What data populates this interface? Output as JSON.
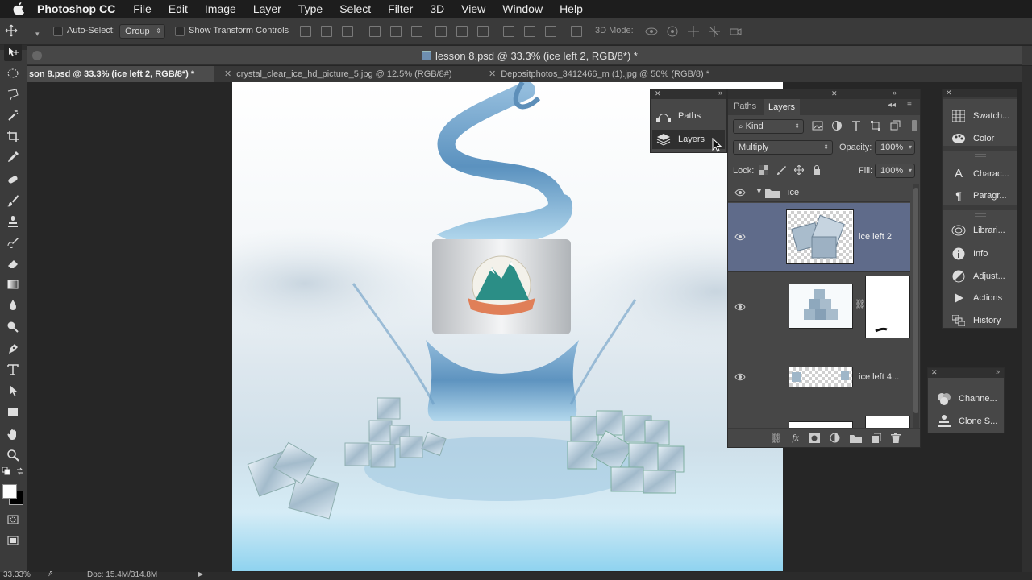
{
  "menubar": {
    "app_name": "Photoshop CC",
    "menus": [
      "File",
      "Edit",
      "Image",
      "Layer",
      "Type",
      "Select",
      "Filter",
      "3D",
      "View",
      "Window",
      "Help"
    ]
  },
  "options_bar": {
    "auto_select_label": "Auto-Select:",
    "auto_select_value": "Group",
    "transform_label": "Show Transform Controls",
    "mode_label": "3D Mode:"
  },
  "document": {
    "title": "lesson 8.psd @ 33.3% (ice left 2, RGB/8*) *",
    "tabs": [
      "son 8.psd @ 33.3% (ice left 2, RGB/8*) *",
      "crystal_clear_ice_hd_picture_5.jpg @ 12.5% (RGB/8#)",
      "Depositphotos_3412466_m (1).jpg @ 50% (RGB/8) *"
    ]
  },
  "status": {
    "zoom": "33.33%",
    "doc": "Doc: 15.4M/314.8M"
  },
  "collapsed_panel_small": {
    "items": [
      "Paths",
      "Layers"
    ]
  },
  "layers_panel": {
    "tabs": [
      "Paths",
      "Layers"
    ],
    "filter_kind": "Kind",
    "blend_mode": "Multiply",
    "opacity_label": "Opacity:",
    "opacity_value": "100%",
    "lock_label": "Lock:",
    "fill_label": "Fill:",
    "fill_value": "100%",
    "group_name": "ice",
    "layers": [
      {
        "name": "ice left 2",
        "selected": true
      },
      {
        "name": "",
        "selected": false
      },
      {
        "name": "ice left 4...",
        "selected": false
      }
    ]
  },
  "right_dock": {
    "group1": [
      "Swatch...",
      "Color"
    ],
    "group2": [
      "Charac...",
      "Paragr..."
    ],
    "group3": [
      "Librari...",
      "Info",
      "Adjust...",
      "Actions",
      "History"
    ]
  },
  "bottom_dock": {
    "items": [
      "Channe...",
      "Clone S..."
    ]
  },
  "colors": {
    "selected_layer": "#5f6b8a",
    "menubar_bg": "#1d1d1d",
    "panel_bg": "#474747"
  }
}
